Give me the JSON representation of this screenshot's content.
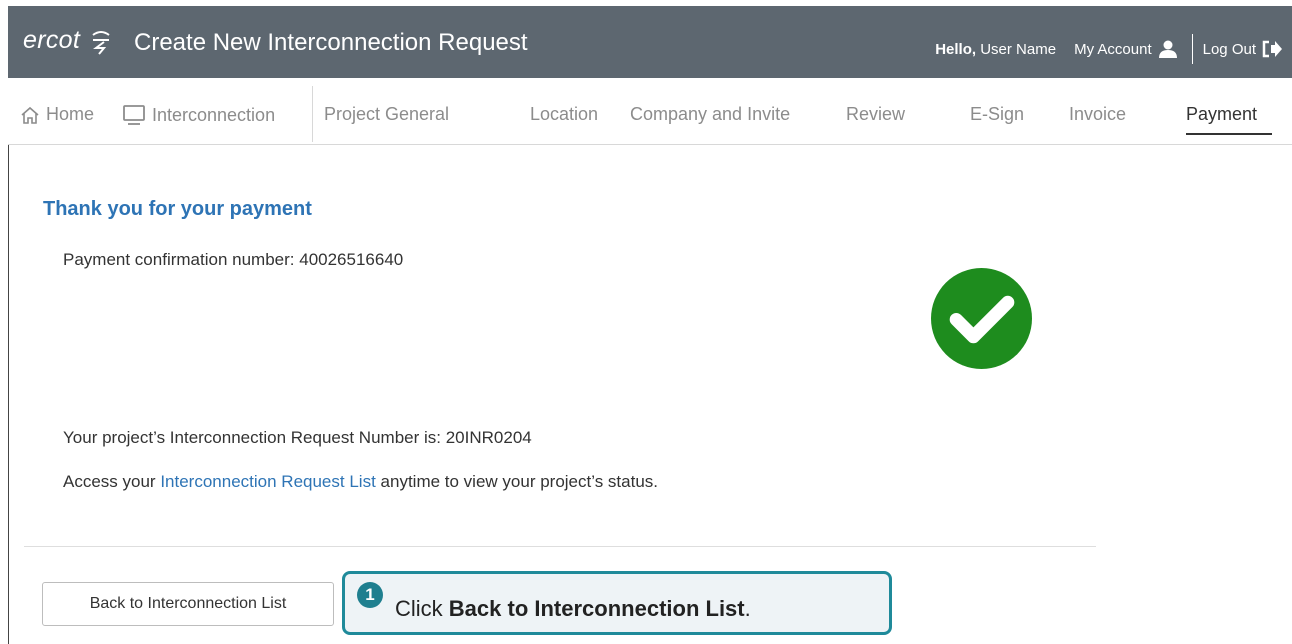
{
  "header": {
    "logo_text": "ercot",
    "title": "Create New Interconnection Request",
    "hello_label": "Hello,",
    "user_name": "User Name",
    "my_account": "My Account",
    "log_out": "Log Out"
  },
  "nav": {
    "home": "Home",
    "interconnection": "Interconnection",
    "steps": [
      "Project General",
      "Location",
      "Company and Invite",
      "Review",
      "E-Sign",
      "Invoice",
      "Payment"
    ],
    "active_step": "Payment"
  },
  "main": {
    "heading": "Thank you for your payment",
    "confirmation_label": "Payment confirmation number:",
    "confirmation_number": "40026516640",
    "request_label": "Your project’s Interconnection Request Number is:",
    "request_number": "20INR0204",
    "access_prefix": "Access your",
    "access_link": "Interconnection Request List",
    "access_suffix": "anytime to view your project’s status."
  },
  "actions": {
    "back_button": "Back to Interconnection List"
  },
  "callout": {
    "number": "1",
    "prefix": "Click",
    "bold": "Back to Interconnection List",
    "suffix": "."
  },
  "colors": {
    "header_bg": "#5d6770",
    "accent_blue": "#2e74b5",
    "success_green": "#1e8c1e",
    "callout_border": "#1f8a9a"
  },
  "icons": [
    "home-icon",
    "monitor-icon",
    "user-icon",
    "logout-icon",
    "check-circle-icon",
    "ercot-logo-mark"
  ]
}
